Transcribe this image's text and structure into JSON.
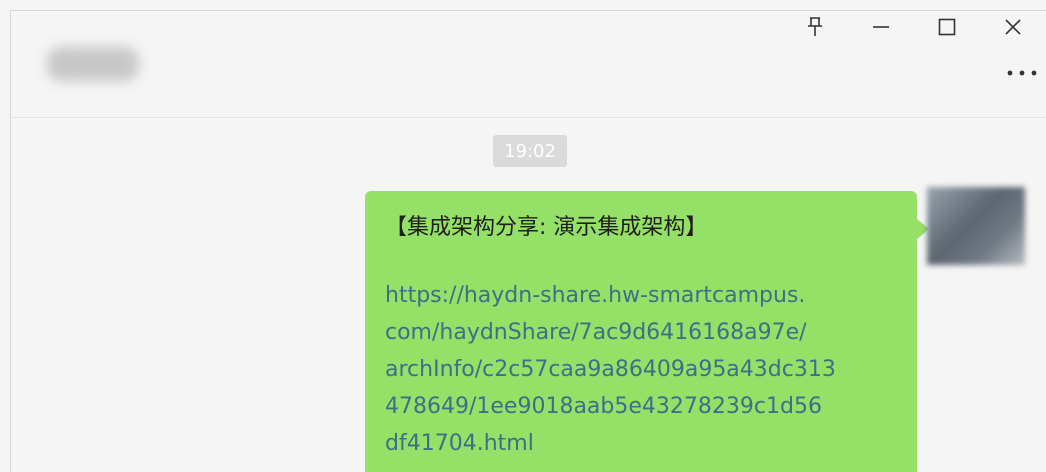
{
  "window": {
    "controls": {
      "pin_icon": "pin-icon",
      "minimize_icon": "minimize-icon",
      "maximize_icon": "maximize-icon",
      "close_icon": "close-icon"
    },
    "more_icon": "more-dots-icon"
  },
  "chat": {
    "timestamp": "19:02",
    "messages": [
      {
        "title": "【集成架构分享: 演示集成架构】",
        "link_lines": [
          "https://haydn-share.hw-smartcampus.",
          "com/haydnShare/7ac9d6416168a97e/",
          "archInfo/c2c57caa9a86409a95a43dc313",
          "478649/1ee9018aab5e43278239c1d56",
          "df41704.html"
        ],
        "bubble_color": "#95e066",
        "link_color": "#3d6f88"
      }
    ]
  }
}
